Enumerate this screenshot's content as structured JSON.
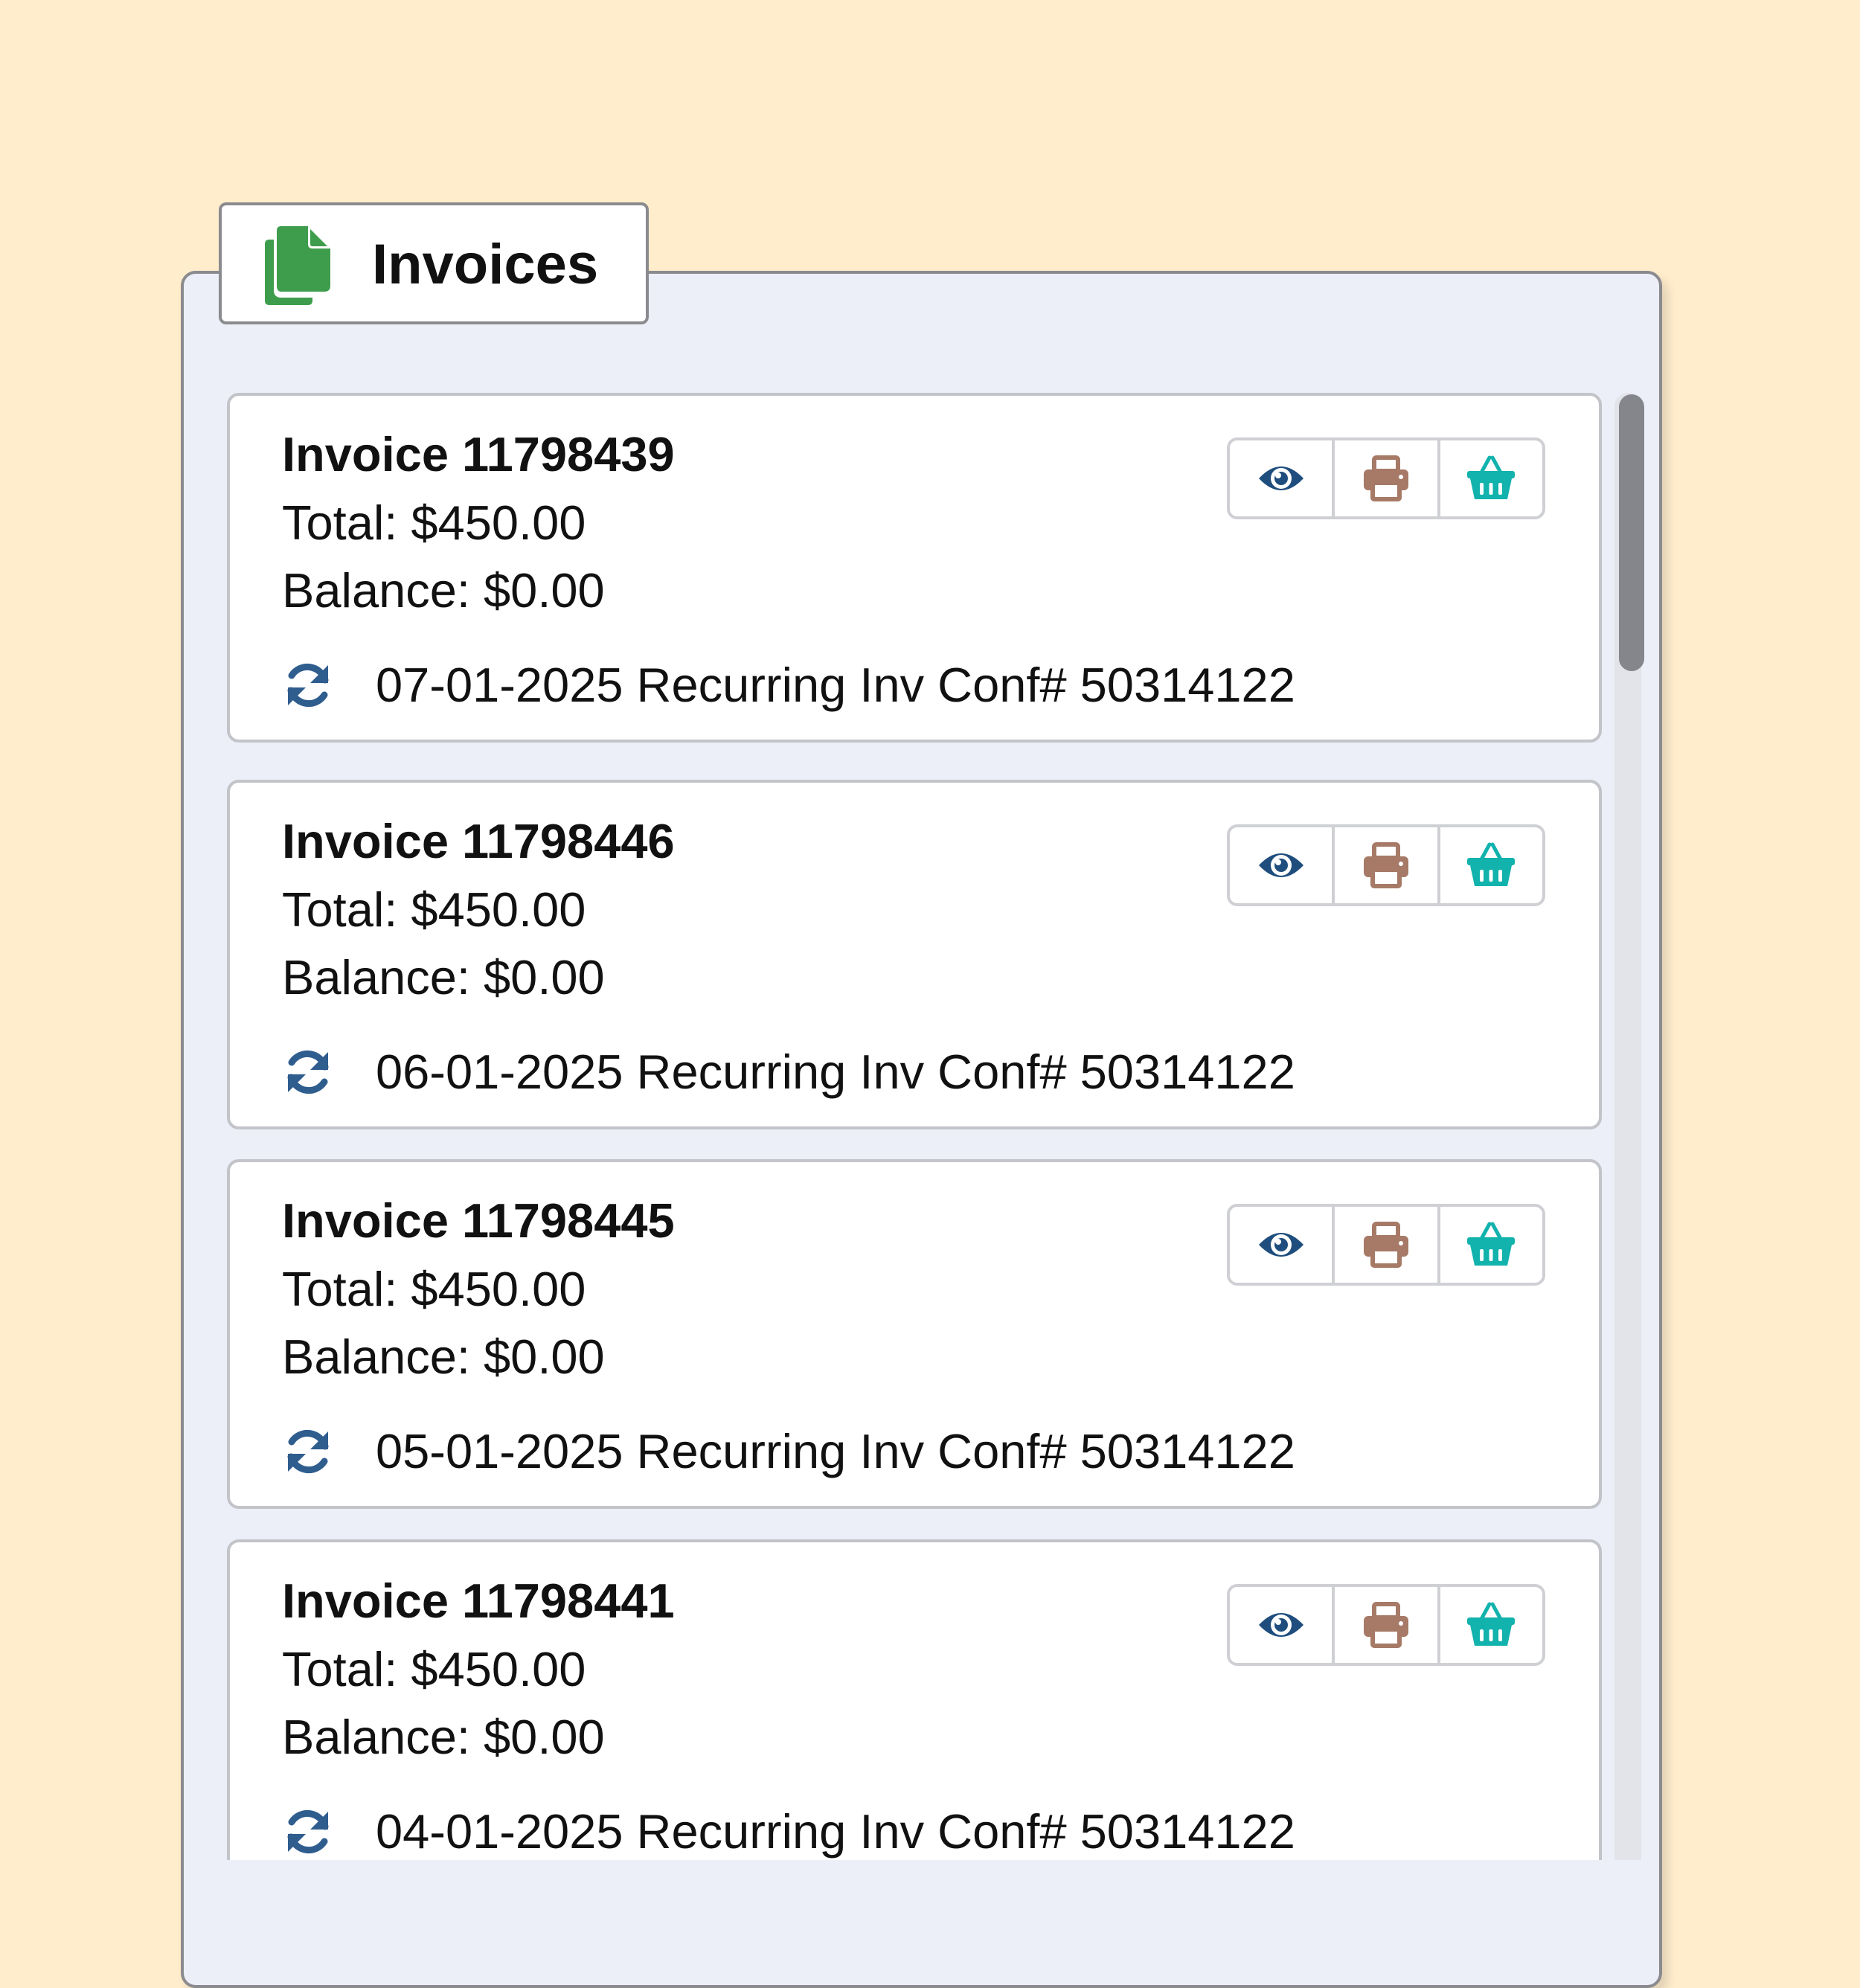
{
  "header": {
    "title": "Invoices"
  },
  "colors": {
    "background": "#ffedcc",
    "panel": "#eceef8",
    "doc_icon": "#3e9d4c",
    "view_icon": "#1f4e7e",
    "print_icon": "#a67a66",
    "basket_icon": "#12b2ad",
    "recur_icon": "#2f5d8e"
  },
  "invoices": [
    {
      "title": "Invoice 11798439",
      "total": "Total: $450.00",
      "balance": "Balance: $0.00",
      "recurring": "07-01-2025 Recurring Inv Conf# 50314122"
    },
    {
      "title": "Invoice 11798446",
      "total": "Total: $450.00",
      "balance": "Balance: $0.00",
      "recurring": "06-01-2025 Recurring Inv Conf# 50314122"
    },
    {
      "title": "Invoice 11798445",
      "total": "Total: $450.00",
      "balance": "Balance: $0.00",
      "recurring": "05-01-2025 Recurring Inv Conf# 50314122"
    },
    {
      "title": "Invoice 11798441",
      "total": "Total: $450.00",
      "balance": "Balance: $0.00",
      "recurring": "04-01-2025 Recurring Inv Conf# 50314122"
    }
  ],
  "icons": {
    "tab": "documents-icon",
    "view": "eye-icon",
    "print": "printer-icon",
    "cart": "basket-icon",
    "recurring": "refresh-icon"
  }
}
